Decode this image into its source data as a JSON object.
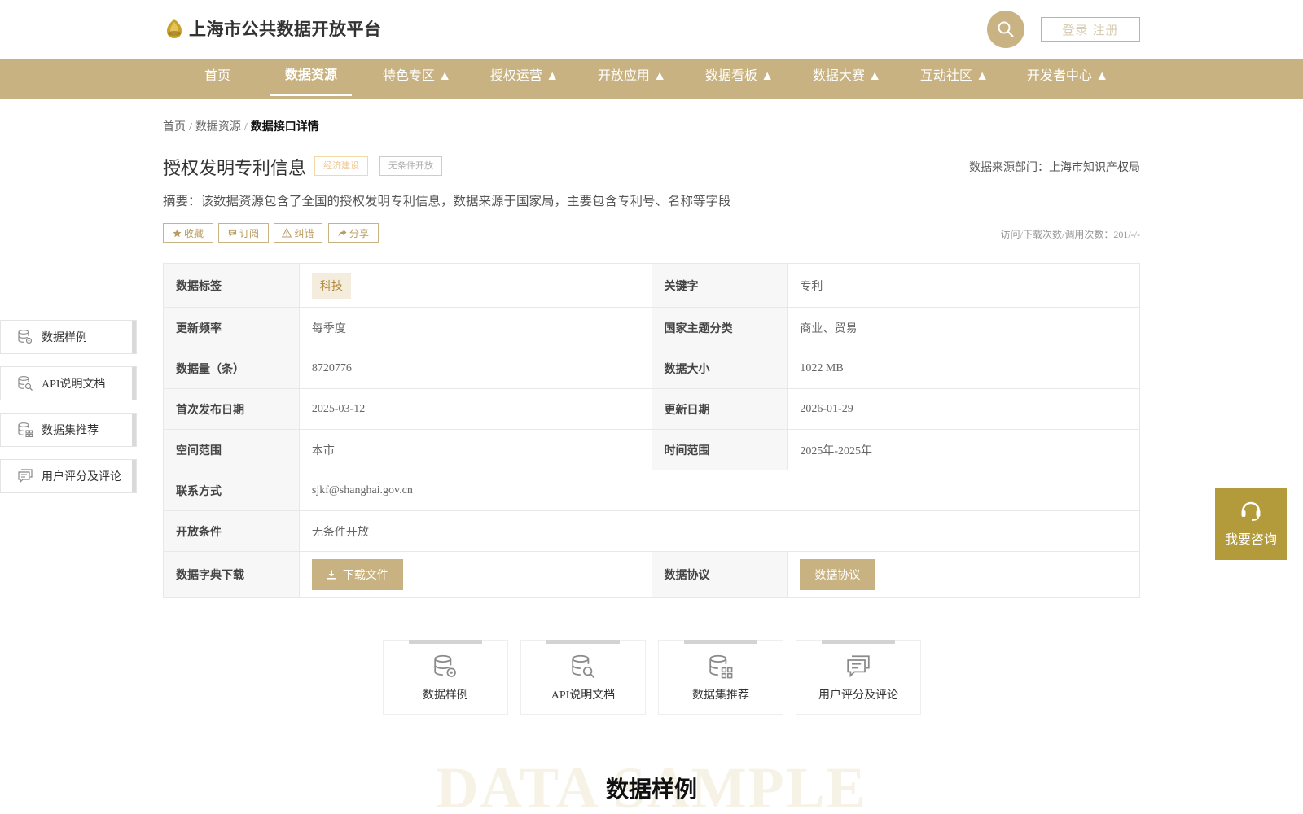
{
  "header": {
    "site_title": "上海市公共数据开放平台",
    "login_label": "登录 注册"
  },
  "nav": {
    "items": [
      {
        "label": "首页"
      },
      {
        "label": "数据资源"
      },
      {
        "label": "特色专区 ▲"
      },
      {
        "label": "授权运营 ▲"
      },
      {
        "label": "开放应用 ▲"
      },
      {
        "label": "数据看板 ▲"
      },
      {
        "label": "数据大赛 ▲"
      },
      {
        "label": "互动社区 ▲"
      },
      {
        "label": "开发者中心 ▲"
      }
    ],
    "active_index": 1
  },
  "breadcrumb": {
    "home": "首页",
    "resources": "数据资源",
    "current": "数据接口详情",
    "separator": "/"
  },
  "detail": {
    "title": "授权发明专利信息",
    "tag_economy": "经济建设",
    "tag_open": "无条件开放",
    "source_dept": "数据来源部门：上海市知识产权局",
    "summary": "摘要：该数据资源包含了全国的授权发明专利信息，数据来源于国家局，主要包含专利号、名称等字段",
    "stats": "访问/下载次数/调用次数：201/-/-"
  },
  "actions": {
    "favorite": "收藏",
    "subscribe": "订阅",
    "report": "纠错",
    "share": "分享"
  },
  "table": {
    "data_tag_label": "数据标签",
    "data_tag_value": "科技",
    "keyword_label": "关键字",
    "keyword_value": "专利",
    "freq_label": "更新频率",
    "freq_value": "每季度",
    "theme_label": "国家主题分类",
    "theme_value": "商业、贸易",
    "count_label": "数据量（条）",
    "count_value": "8720776",
    "size_label": "数据大小",
    "size_value": "1022 MB",
    "first_pub_label": "首次发布日期",
    "first_pub_value": "2025-03-12",
    "update_label": "更新日期",
    "update_value": "2026-01-29",
    "space_label": "空间范围",
    "space_value": "本市",
    "time_label": "时间范围",
    "time_value": "2025年-2025年",
    "contact_label": "联系方式",
    "contact_value": "sjkf@shanghai.gov.cn",
    "condition_label": "开放条件",
    "condition_value": "无条件开放",
    "dict_label": "数据字典下载",
    "dict_button": "下载文件",
    "protocol_label": "数据协议",
    "protocol_button": "数据协议"
  },
  "side_nav": {
    "items": [
      {
        "label": "数据样例",
        "icon": "database-gear-icon"
      },
      {
        "label": "API说明文档",
        "icon": "database-search-icon"
      },
      {
        "label": "数据集推荐",
        "icon": "database-grid-icon"
      },
      {
        "label": "用户评分及评论",
        "icon": "comment-icon"
      }
    ]
  },
  "consult": {
    "label": "我要咨询"
  },
  "cards": {
    "items": [
      {
        "label": "数据样例"
      },
      {
        "label": "API说明文档"
      },
      {
        "label": "数据集推荐"
      },
      {
        "label": "用户评分及评论"
      }
    ]
  },
  "section": {
    "bg_text": "DATA SAMPLE",
    "title": "数据样例"
  },
  "colors": {
    "brand_gold": "#c8b281",
    "consult_gold": "#b39a3b"
  }
}
